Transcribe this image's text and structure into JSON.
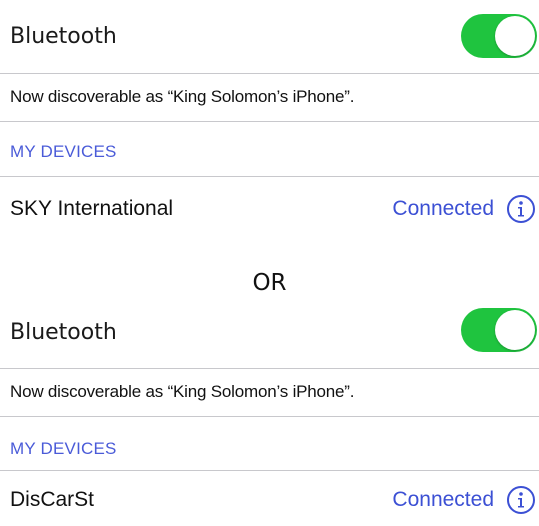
{
  "panels": [
    {
      "bluetooth_label": "Bluetooth",
      "bluetooth_on": true,
      "discoverable_text": "Now discoverable as “King Solomon’s iPhone”.",
      "section_header": "MY DEVICES",
      "device": {
        "name": "SKY International",
        "status": "Connected",
        "status_color": "#3c50d4"
      }
    },
    {
      "bluetooth_label": "Bluetooth",
      "bluetooth_on": true,
      "discoverable_text": "Now discoverable as “King Solomon’s iPhone”.",
      "section_header": "MY DEVICES",
      "device": {
        "name": "DisCarSt",
        "status": "Connected",
        "status_color": "#3c50d4"
      }
    }
  ],
  "separator_text": "OR",
  "colors": {
    "toggle_on": "#1fc43f",
    "accent": "#3c50d4",
    "section_header": "#4a5bd8",
    "divider": "#c8c8cc"
  },
  "icons": {
    "info": "info-circle-icon",
    "toggle": "toggle-switch"
  }
}
